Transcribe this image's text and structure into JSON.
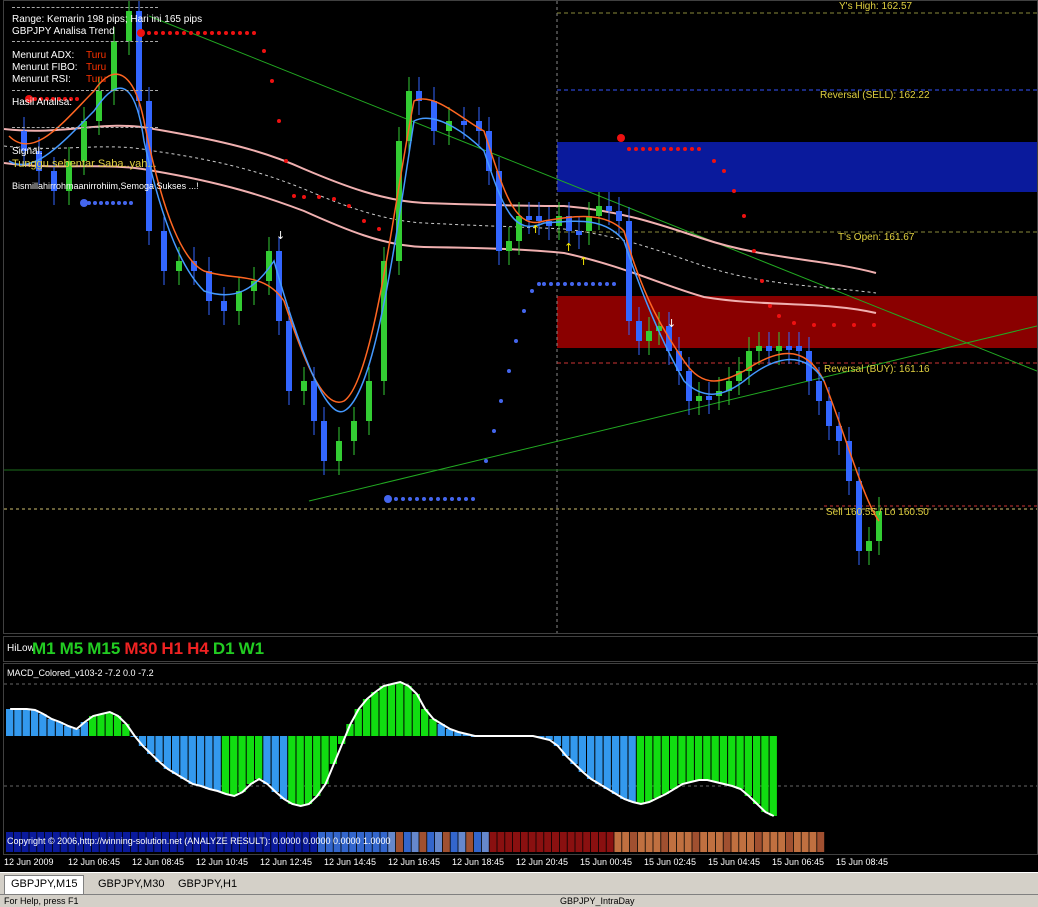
{
  "symbol_info": {
    "range_line": "Range: Kemarin 198 pips; Hari ini 165 pips",
    "trend_title": "GBPJPY Analisa Trend",
    "adx_label": "Menurut ADX:",
    "fibo_label": "Menurut FIBO:",
    "rsi_label": "Menurut RSI:",
    "adx_value": "Turu",
    "fibo_value": "Turu",
    "rsi_value": "Turu",
    "analysis_label": "Hasil Analisa:",
    "signal_label": "Signal:",
    "signal_text": "Tunggu sebentar Saba..yah...",
    "prayer_text": "Bismillahirrohmaanirrohiim,Semoga Sukses ...!"
  },
  "levels": {
    "ys_high": "Y's High: 162.57",
    "reversal_sell": "Reversal (SELL): 162.22",
    "ts_open": "T's Open: 161.67",
    "reversal_buy": "Reversal (BUY): 161.16",
    "current_label": "Sell 160.55 / Lo 160.50"
  },
  "hilow": {
    "label": "HiLow",
    "timeframes": [
      {
        "name": "M1",
        "color": "#22cc22"
      },
      {
        "name": "M5",
        "color": "#22cc22"
      },
      {
        "name": "M15",
        "color": "#22cc22"
      },
      {
        "name": "M30",
        "color": "#ee2222"
      },
      {
        "name": "H1",
        "color": "#ee2222"
      },
      {
        "name": "H4",
        "color": "#ee2222"
      },
      {
        "name": "D1",
        "color": "#22cc22"
      },
      {
        "name": "W1",
        "color": "#22cc22"
      }
    ]
  },
  "macd": {
    "title": "MACD_Colored_v103-2 -7.2 0.0 -7.2",
    "copyright": "Copyright © 2006,http://winning-solution.net (ANALYZE RESULT): 0.0000 0.0000 0.0000 1.0000"
  },
  "time_axis": [
    "12 Jun 2009",
    "12 Jun 06:45",
    "12 Jun 08:45",
    "12 Jun 10:45",
    "12 Jun 12:45",
    "12 Jun 14:45",
    "12 Jun 16:45",
    "12 Jun 18:45",
    "12 Jun 20:45",
    "15 Jun 00:45",
    "15 Jun 02:45",
    "15 Jun 04:45",
    "15 Jun 06:45",
    "15 Jun 08:45"
  ],
  "tabs": [
    "GBPJPY,M15",
    "GBPJPY,M30",
    "GBPJPY,H1"
  ],
  "active_tab": "GBPJPY,M15",
  "status": {
    "left": "For Help, press F1",
    "right": "GBPJPY_IntraDay"
  },
  "colors": {
    "sell_zone": "#0a1a9c",
    "buy_zone": "#8a0000",
    "bull_candle": "#33cc33",
    "bear_candle": "#3366ff",
    "trendline": "#22aa22",
    "sar_red": "#ee1111",
    "sar_blue": "#4466ee",
    "ma_pink": "#f0b0b0",
    "macd_green": "#11dd11",
    "macd_blue": "#3399ee"
  }
}
